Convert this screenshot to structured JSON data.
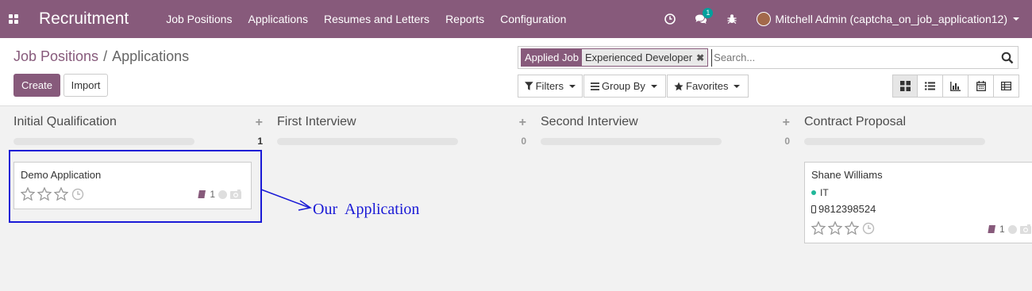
{
  "navbar": {
    "app_name": "Recruitment",
    "menus": [
      "Job Positions",
      "Applications",
      "Resumes and Letters",
      "Reports",
      "Configuration"
    ],
    "messages_count": "1",
    "user_name": "Mitchell Admin (captcha_on_job_application12)"
  },
  "breadcrumb": {
    "parent": "Job Positions",
    "separator": "/",
    "current": "Applications"
  },
  "buttons": {
    "create": "Create",
    "import": "Import"
  },
  "search": {
    "facet_category": "Applied Job",
    "facet_value": "Experienced Developer",
    "placeholder": "Search..."
  },
  "filters": {
    "filters": "Filters",
    "group_by": "Group By",
    "favorites": "Favorites"
  },
  "views": [
    "kanban-icon",
    "list-icon",
    "graph-icon",
    "calendar-icon",
    "pivot-icon"
  ],
  "columns": [
    {
      "title": "Initial Qualification",
      "count": "1"
    },
    {
      "title": "First Interview",
      "count": "0"
    },
    {
      "title": "Second Interview",
      "count": "0"
    },
    {
      "title": "Contract Proposal",
      "count": ""
    }
  ],
  "cards": [
    {
      "name": "Demo Application",
      "attachments": "1"
    },
    {
      "name": "Shane Williams",
      "tag": "IT",
      "phone": "9812398524",
      "attachments": "1"
    }
  ],
  "annotation": {
    "label": "Our  Application",
    "color": "#1a1ad6"
  },
  "colors": {
    "brand": "#875a7b",
    "badge": "#00a09d",
    "tag_dot": "#21b799"
  }
}
